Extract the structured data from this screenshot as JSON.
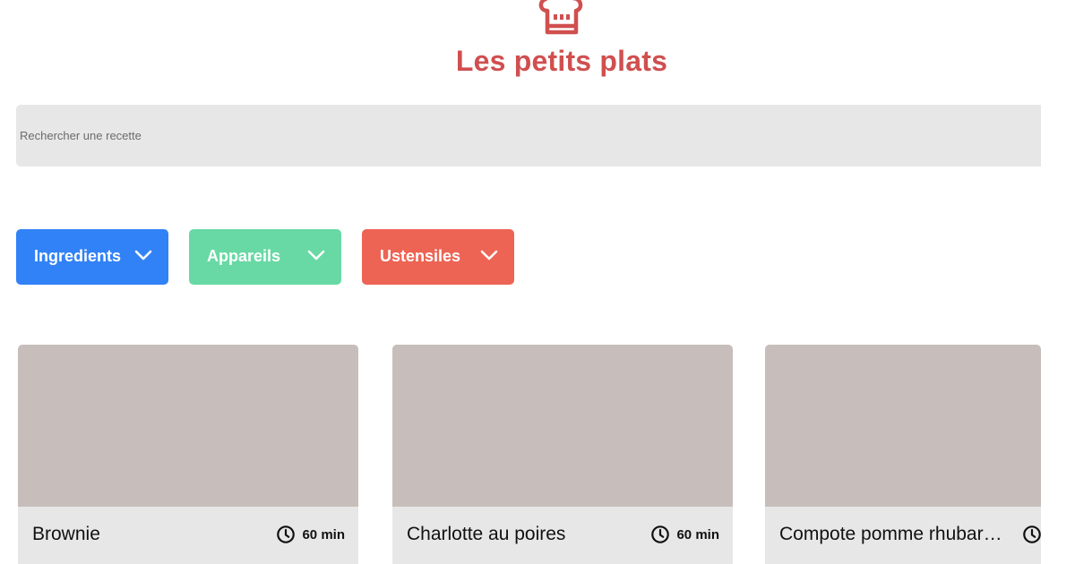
{
  "header": {
    "logo_icon": "chef-hat-icon",
    "title": "Les petits plats",
    "accent_color": "#d04f4f"
  },
  "search": {
    "placeholder": "Rechercher une recette",
    "value": ""
  },
  "filters": [
    {
      "label": "Ingredients",
      "color": "#3282f7",
      "icon": "chevron-down-icon"
    },
    {
      "label": "Appareils",
      "color": "#68d9a4",
      "icon": "chevron-down-icon"
    },
    {
      "label": "Ustensiles",
      "color": "#ed6454",
      "icon": "chevron-down-icon"
    }
  ],
  "recipes": [
    {
      "name": "Brownie",
      "time": "60 min",
      "time_icon": "clock-icon"
    },
    {
      "name": "Charlotte au poires",
      "time": "60 min",
      "time_icon": "clock-icon"
    },
    {
      "name": "Compote pomme rhubarbe",
      "time": "",
      "time_icon": "clock-icon"
    }
  ]
}
